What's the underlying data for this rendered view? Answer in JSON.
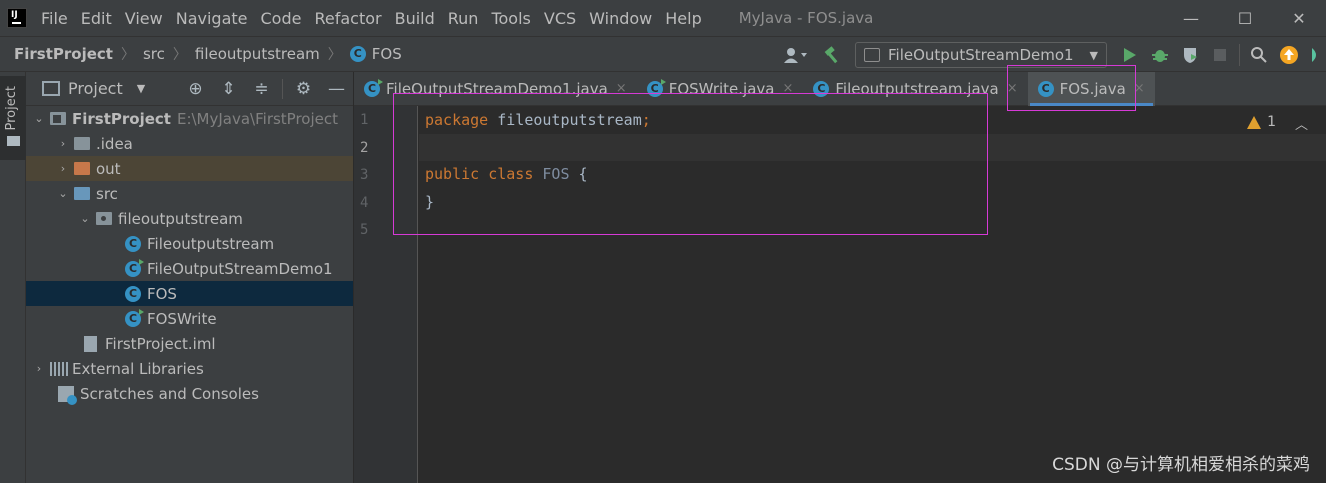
{
  "menu": {
    "items": [
      "File",
      "Edit",
      "View",
      "Navigate",
      "Code",
      "Refactor",
      "Build",
      "Run",
      "Tools",
      "VCS",
      "Window",
      "Help"
    ],
    "window_title": "MyJava - FOS.java"
  },
  "window_controls": {
    "minimize": "—",
    "maximize": "☐",
    "close": "✕"
  },
  "breadcrumb": {
    "project": "FirstProject",
    "src": "src",
    "package": "fileoutputstream",
    "class_icon": "C",
    "class": "FOS"
  },
  "toolbar": {
    "run_config": "FileOutputStreamDemo1",
    "icons": [
      "user-icon",
      "hammer-icon",
      "run-icon",
      "debug-icon",
      "coverage-icon",
      "stop-icon",
      "search-icon",
      "update-icon"
    ]
  },
  "left_strip": {
    "tab_label": "Project"
  },
  "project_panel": {
    "title": "Project",
    "tree": [
      {
        "label": "FirstProject",
        "extra": "E:\\MyJava\\FirstProject"
      },
      {
        "label": ".idea"
      },
      {
        "label": "out"
      },
      {
        "label": "src"
      },
      {
        "label": "fileoutputstream"
      },
      {
        "label": "Fileoutputstream"
      },
      {
        "label": "FileOutputStreamDemo1"
      },
      {
        "label": "FOS"
      },
      {
        "label": "FOSWrite"
      },
      {
        "label": "FirstProject.iml"
      },
      {
        "label": "External Libraries"
      },
      {
        "label": "Scratches and Consoles"
      }
    ]
  },
  "editor_tabs": [
    {
      "label": "FileOutputStreamDemo1.java",
      "close": "×"
    },
    {
      "label": "FOSWrite.java",
      "close": "×"
    },
    {
      "label": "Fileoutputstream.java",
      "close": "×"
    },
    {
      "label": "FOS.java",
      "close": "×"
    }
  ],
  "editor": {
    "line_numbers": [
      "1",
      "2",
      "3",
      "4",
      "5"
    ],
    "lines": {
      "l1_kw": "package",
      "l1_rest": " fileoutputstream",
      "l1_semi": ";",
      "l3_kw1": "public",
      "l3_kw2": "class",
      "l3_cls": "FOS",
      "l3_brace": "{",
      "l4": "}"
    },
    "warning_count": "1"
  },
  "watermark": "CSDN @与计算机相爱相杀的菜鸡",
  "colors": {
    "accent": "#4a88c7",
    "keyword": "#cc7832",
    "highlight_box": "#d63ad6"
  }
}
